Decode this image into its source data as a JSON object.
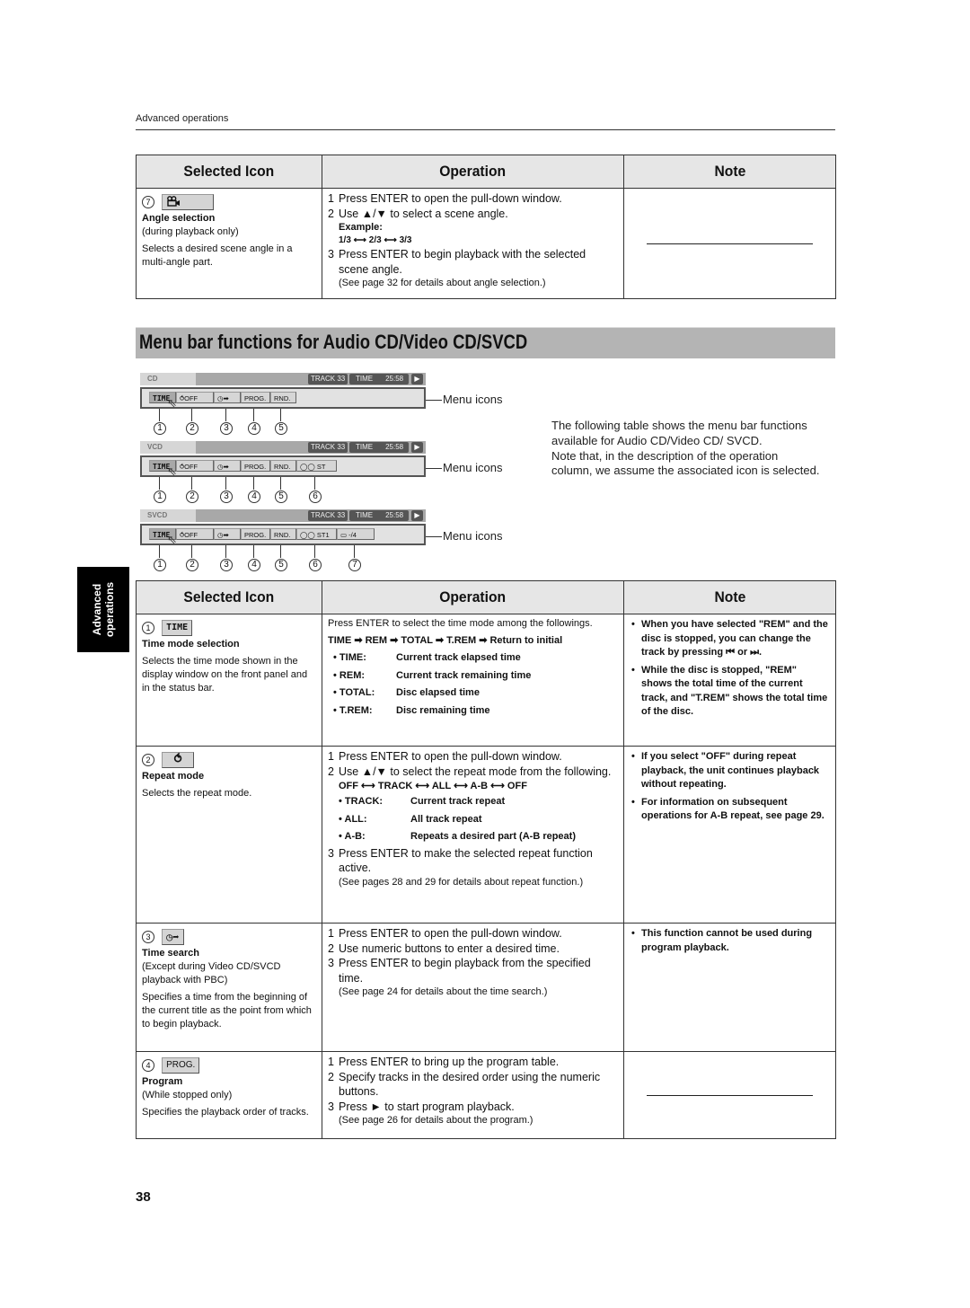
{
  "page": {
    "running_head": "Advanced operations",
    "page_number": "38",
    "side_tab": [
      "Advanced",
      "operations"
    ]
  },
  "table_headers": {
    "selected_icon": "Selected Icon",
    "operation": "Operation",
    "note": "Note"
  },
  "top_table": {
    "row": {
      "callout": "7",
      "icon": "camera-icon",
      "title": "Angle selection",
      "condition": "(during playback only)",
      "description": "Selects a desired scene angle in a multi-angle part.",
      "steps": [
        {
          "n": "1",
          "text": "Press ENTER to open the pull-down window."
        },
        {
          "n": "2",
          "text": "Use ▲/▼ to select a scene angle."
        },
        {
          "n": "3",
          "text": "Press ENTER to begin playback with the selected scene angle."
        }
      ],
      "example_label": "Example:",
      "example_sequence": "1/3 ⟷ 2/3 ⟷ 3/3",
      "reference": "(See page 32 for details about angle selection.)",
      "note": "—"
    }
  },
  "section": {
    "title": "Menu bar functions for Audio CD/Video CD/SVCD",
    "intro": "The following table shows the menu bar functions available for Audio CD/Video CD/ SVCD.\nNote that, in the description of the operation column, we assume the associated icon is selected."
  },
  "menu_bars": [
    {
      "disc": "CD",
      "track": "TRACK 33",
      "time_label": "TIME",
      "time_value": "25:58",
      "play": "▶",
      "chips": [
        "TIME",
        "⥀OFF",
        "◷➡",
        "PROG.",
        "RND."
      ],
      "label": "Menu icons",
      "callouts": [
        "1",
        "2",
        "3",
        "4",
        "5"
      ]
    },
    {
      "disc": "VCD",
      "track": "TRACK 33",
      "time_label": "TIME",
      "time_value": "25:58",
      "play": "▶",
      "chips": [
        "TIME",
        "⥀OFF",
        "◷➡",
        "PROG.",
        "RND.",
        "◯◯ ST"
      ],
      "label": "Menu icons",
      "callouts": [
        "1",
        "2",
        "3",
        "4",
        "5",
        "6"
      ]
    },
    {
      "disc": "SVCD",
      "track": "TRACK 33",
      "time_label": "TIME",
      "time_value": "25:58",
      "play": "▶",
      "chips": [
        "TIME",
        "⥀OFF",
        "◷➡",
        "PROG.",
        "RND.",
        "◯◯ ST1",
        "▭ -/4"
      ],
      "label": "Menu icons",
      "callouts": [
        "1",
        "2",
        "3",
        "4",
        "5",
        "6",
        "7"
      ]
    }
  ],
  "main_table": {
    "rows": [
      {
        "callout": "1",
        "icon_label": "TIME",
        "title": "Time mode selection",
        "description": "Selects the time mode shown in the display window on the front panel and in the status bar.",
        "intro": "Press ENTER to select the time mode among the followings.",
        "sequence": "TIME ➡ REM ➡ TOTAL ➡ T.REM ➡ Return to initial",
        "definitions": [
          {
            "key": "TIME:",
            "value": "Current track elapsed time"
          },
          {
            "key": "REM:",
            "value": "Current track remaining time"
          },
          {
            "key": "TOTAL:",
            "value": "Disc elapsed time"
          },
          {
            "key": "T.REM:",
            "value": "Disc remaining time"
          }
        ],
        "notes": [
          "When you have selected \"REM\" and the disc is stopped, you can change the track by pressing ⏮ or ⏭.",
          "While the disc is stopped, \"REM\" shows the total time of the current track, and \"T.REM\" shows the total time of the disc."
        ]
      },
      {
        "callout": "2",
        "icon_label": "⥀",
        "title": "Repeat mode",
        "description": "Selects the repeat mode.",
        "steps": [
          {
            "n": "1",
            "text": "Press ENTER to open the pull-down window."
          },
          {
            "n": "2",
            "text": "Use ▲/▼ to select the repeat mode from the following."
          },
          {
            "n": "3",
            "text": "Press ENTER to make the selected repeat function active."
          }
        ],
        "sequence": "OFF ⟷ TRACK ⟷ ALL ⟷ A-B ⟷ OFF",
        "definitions": [
          {
            "key": "• TRACK:",
            "value": "Current track repeat"
          },
          {
            "key": "• ALL:",
            "value": "All track repeat"
          },
          {
            "key": "• A-B:",
            "value": "Repeats a desired part (A-B repeat)"
          }
        ],
        "reference": "(See pages 28 and 29 for details about repeat function.)",
        "notes": [
          "If you select \"OFF\" during repeat playback, the unit continues playback without repeating.",
          "For information on subsequent operations for  A-B repeat, see page 29."
        ]
      },
      {
        "callout": "3",
        "icon_label": "◷➡",
        "title": "Time search",
        "condition": "(Except during Video CD/SVCD playback with PBC)",
        "description": "Specifies a time from the beginning of the current title as the point from which to begin playback.",
        "steps": [
          {
            "n": "1",
            "text": "Press ENTER to open the pull-down window."
          },
          {
            "n": "2",
            "text": "Use numeric buttons to enter a desired time."
          },
          {
            "n": "3",
            "text": "Press ENTER to begin playback from the specified time."
          }
        ],
        "reference": "(See page 24 for details about the time search.)",
        "notes": [
          "This function cannot be used during program playback."
        ]
      },
      {
        "callout": "4",
        "icon_label": "PROG.",
        "title": "Program",
        "condition": "(While stopped only)",
        "description": "Specifies the playback order of tracks.",
        "steps": [
          {
            "n": "1",
            "text": "Press ENTER to bring up the program table."
          },
          {
            "n": "2",
            "text": "Specify tracks in the desired order using the numeric buttons."
          },
          {
            "n": "3",
            "text": "Press ► to start program playback."
          }
        ],
        "reference": "(See page 26 for details about the program.)",
        "note": "—"
      }
    ]
  }
}
